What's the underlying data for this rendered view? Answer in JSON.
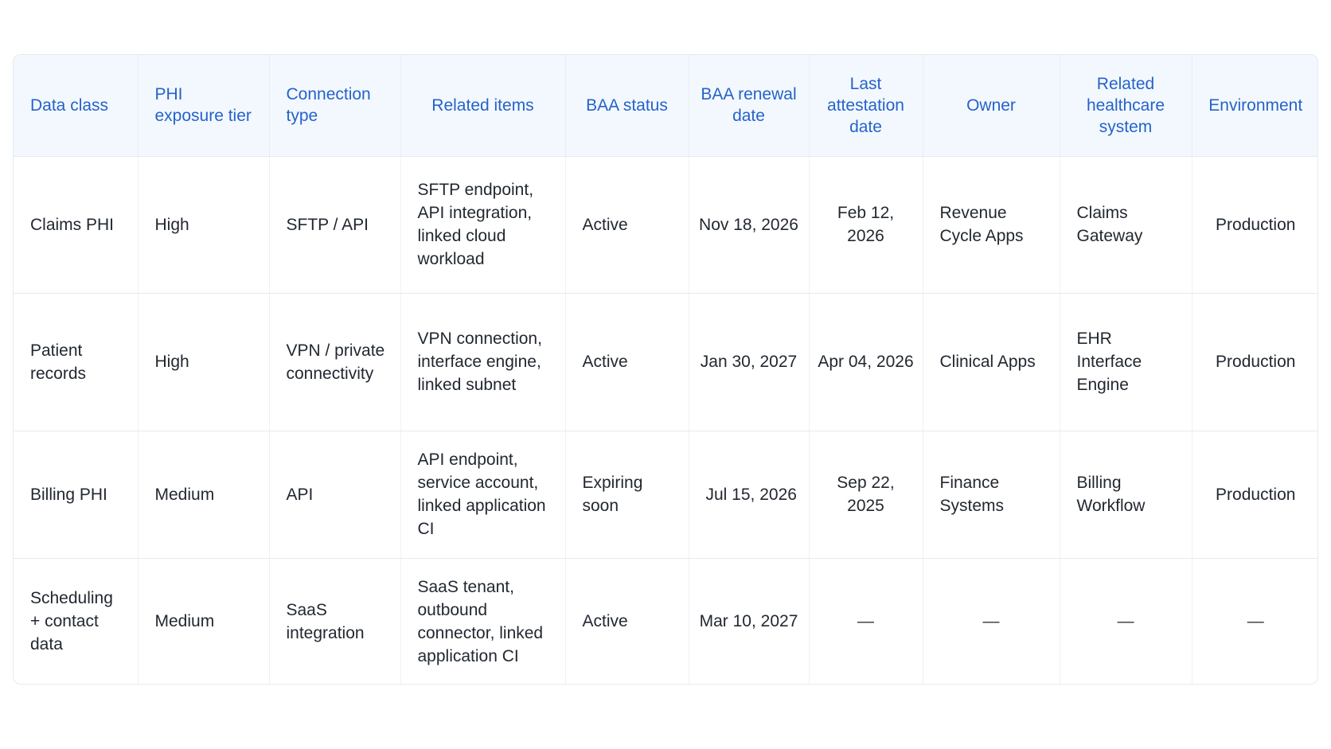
{
  "table": {
    "headers": [
      "Data class",
      "PHI exposure tier",
      "Connection type",
      "Related items",
      "BAA status",
      "BAA renewal date",
      "Last attestation date",
      "Owner",
      "Related healthcare system",
      "Environment"
    ],
    "rows": [
      [
        "Claims PHI",
        "High",
        "SFTP / API",
        "SFTP endpoint, API integration, linked cloud workload",
        "Active",
        "Nov 18, 2026",
        "Feb 12, 2026",
        "Revenue Cycle Apps",
        "Claims Gateway",
        "Production"
      ],
      [
        "Patient records",
        "High",
        "VPN / private connectivity",
        "VPN connection, interface engine, linked subnet",
        "Active",
        "Jan 30, 2027",
        "Apr 04, 2026",
        "Clinical Apps",
        "EHR Interface Engine",
        "Production"
      ],
      [
        "Billing PHI",
        "Medium",
        "API",
        "API endpoint, service account, linked application CI",
        "Expiring soon",
        "Jul 15, 2026",
        "Sep 22, 2025",
        "Finance Systems",
        "Billing Workflow",
        "Production"
      ],
      [
        "Scheduling + contact data",
        "Medium",
        "SaaS integration",
        "SaaS tenant, outbound connector, linked application CI",
        "Active",
        "Mar 10, 2027",
        "—",
        "—",
        "—",
        "—"
      ]
    ]
  },
  "colors": {
    "header_text": "#2563c9",
    "header_bg": "#f3f8fe",
    "body_text": "#222831",
    "border": "#e5eaf1"
  }
}
